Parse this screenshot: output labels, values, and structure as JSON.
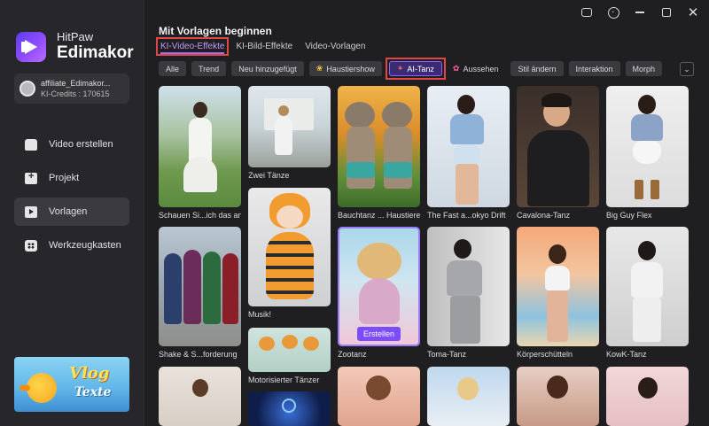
{
  "brand": {
    "name": "HitPaw",
    "product": "Edimakor"
  },
  "account": {
    "name": "affiliate_Edimakor...",
    "credits": "KI-Credits : 170615"
  },
  "nav": [
    {
      "id": "create",
      "label": "Video erstellen"
    },
    {
      "id": "project",
      "label": "Projekt"
    },
    {
      "id": "templates",
      "label": "Vorlagen",
      "active": true
    },
    {
      "id": "toolbox",
      "label": "Werkzeugkasten"
    }
  ],
  "promo": {
    "line1": "Vlog",
    "line2": "Texte"
  },
  "page": {
    "title": "Mit Vorlagen beginnen"
  },
  "tabs": [
    {
      "label": "KI-Video-Effekte",
      "active": true
    },
    {
      "label": "KI-Bild-Effekte"
    },
    {
      "label": "Video-Vorlagen"
    }
  ],
  "chips": [
    {
      "label": "Alle"
    },
    {
      "label": "Trend"
    },
    {
      "label": "Neu hinzugefügt"
    },
    {
      "label": "Haustiershow",
      "icon": "paw-icon"
    },
    {
      "label": "AI-Tanz",
      "icon": "dance-icon",
      "active": true
    },
    {
      "label": "Aussehen",
      "icon": "mustache-icon"
    },
    {
      "label": "Stil ändern"
    },
    {
      "label": "Interaktion"
    },
    {
      "label": "Morph"
    }
  ],
  "create_label": "Erstellen",
  "cards": [
    {
      "label": "Schauen Si...ich das an"
    },
    {
      "label": "Zwei Tänze"
    },
    {
      "label": "Bauchtanz ... Haustiere"
    },
    {
      "label": "The Fast a...okyo Drift"
    },
    {
      "label": "Cavalona-Tanz"
    },
    {
      "label": "Big Guy Flex"
    },
    {
      "label": "Musik!"
    },
    {
      "label": "Shake & S...forderung"
    },
    {
      "label": "Zootanz"
    },
    {
      "label": "Toma-Tanz"
    },
    {
      "label": "Körperschütteln"
    },
    {
      "label": "KowK-Tanz"
    },
    {
      "label": "Motorisierter Tänzer"
    }
  ]
}
